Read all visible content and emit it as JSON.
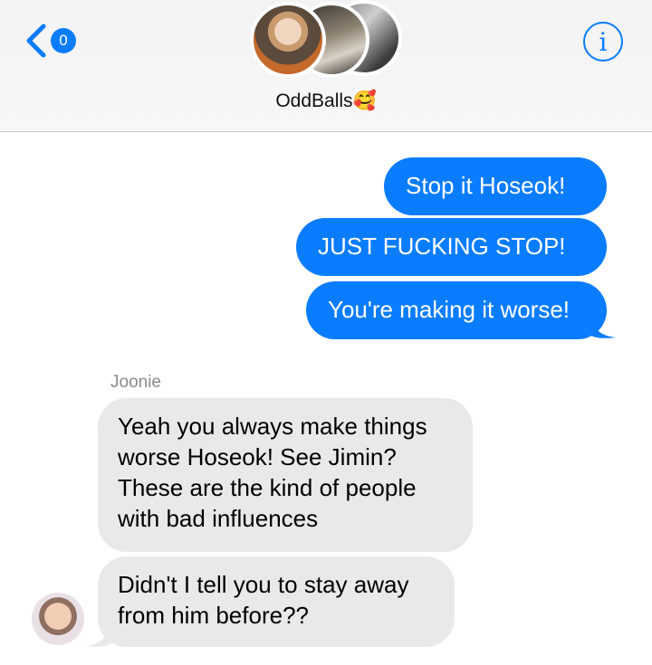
{
  "header": {
    "back_badge": "0",
    "group_name": "OddBalls",
    "group_emoji": "🥰",
    "info_glyph": "i"
  },
  "messages": [
    {
      "direction": "outgoing",
      "text": "Stop it Hoseok!"
    },
    {
      "direction": "outgoing",
      "text": "JUST FUCKING STOP!"
    },
    {
      "direction": "outgoing",
      "text": "You're making it worse!"
    },
    {
      "direction": "incoming",
      "sender": "Joonie",
      "text": "Yeah you always make things worse Hoseok! See Jimin? These are the kind of people with bad influences"
    },
    {
      "direction": "incoming",
      "text": "Didn't I tell you to stay away from him before??"
    }
  ],
  "colors": {
    "accent": "#0a7cff",
    "incoming_bubble": "#e9e9eb",
    "header_bg": "#f4f3f3"
  }
}
